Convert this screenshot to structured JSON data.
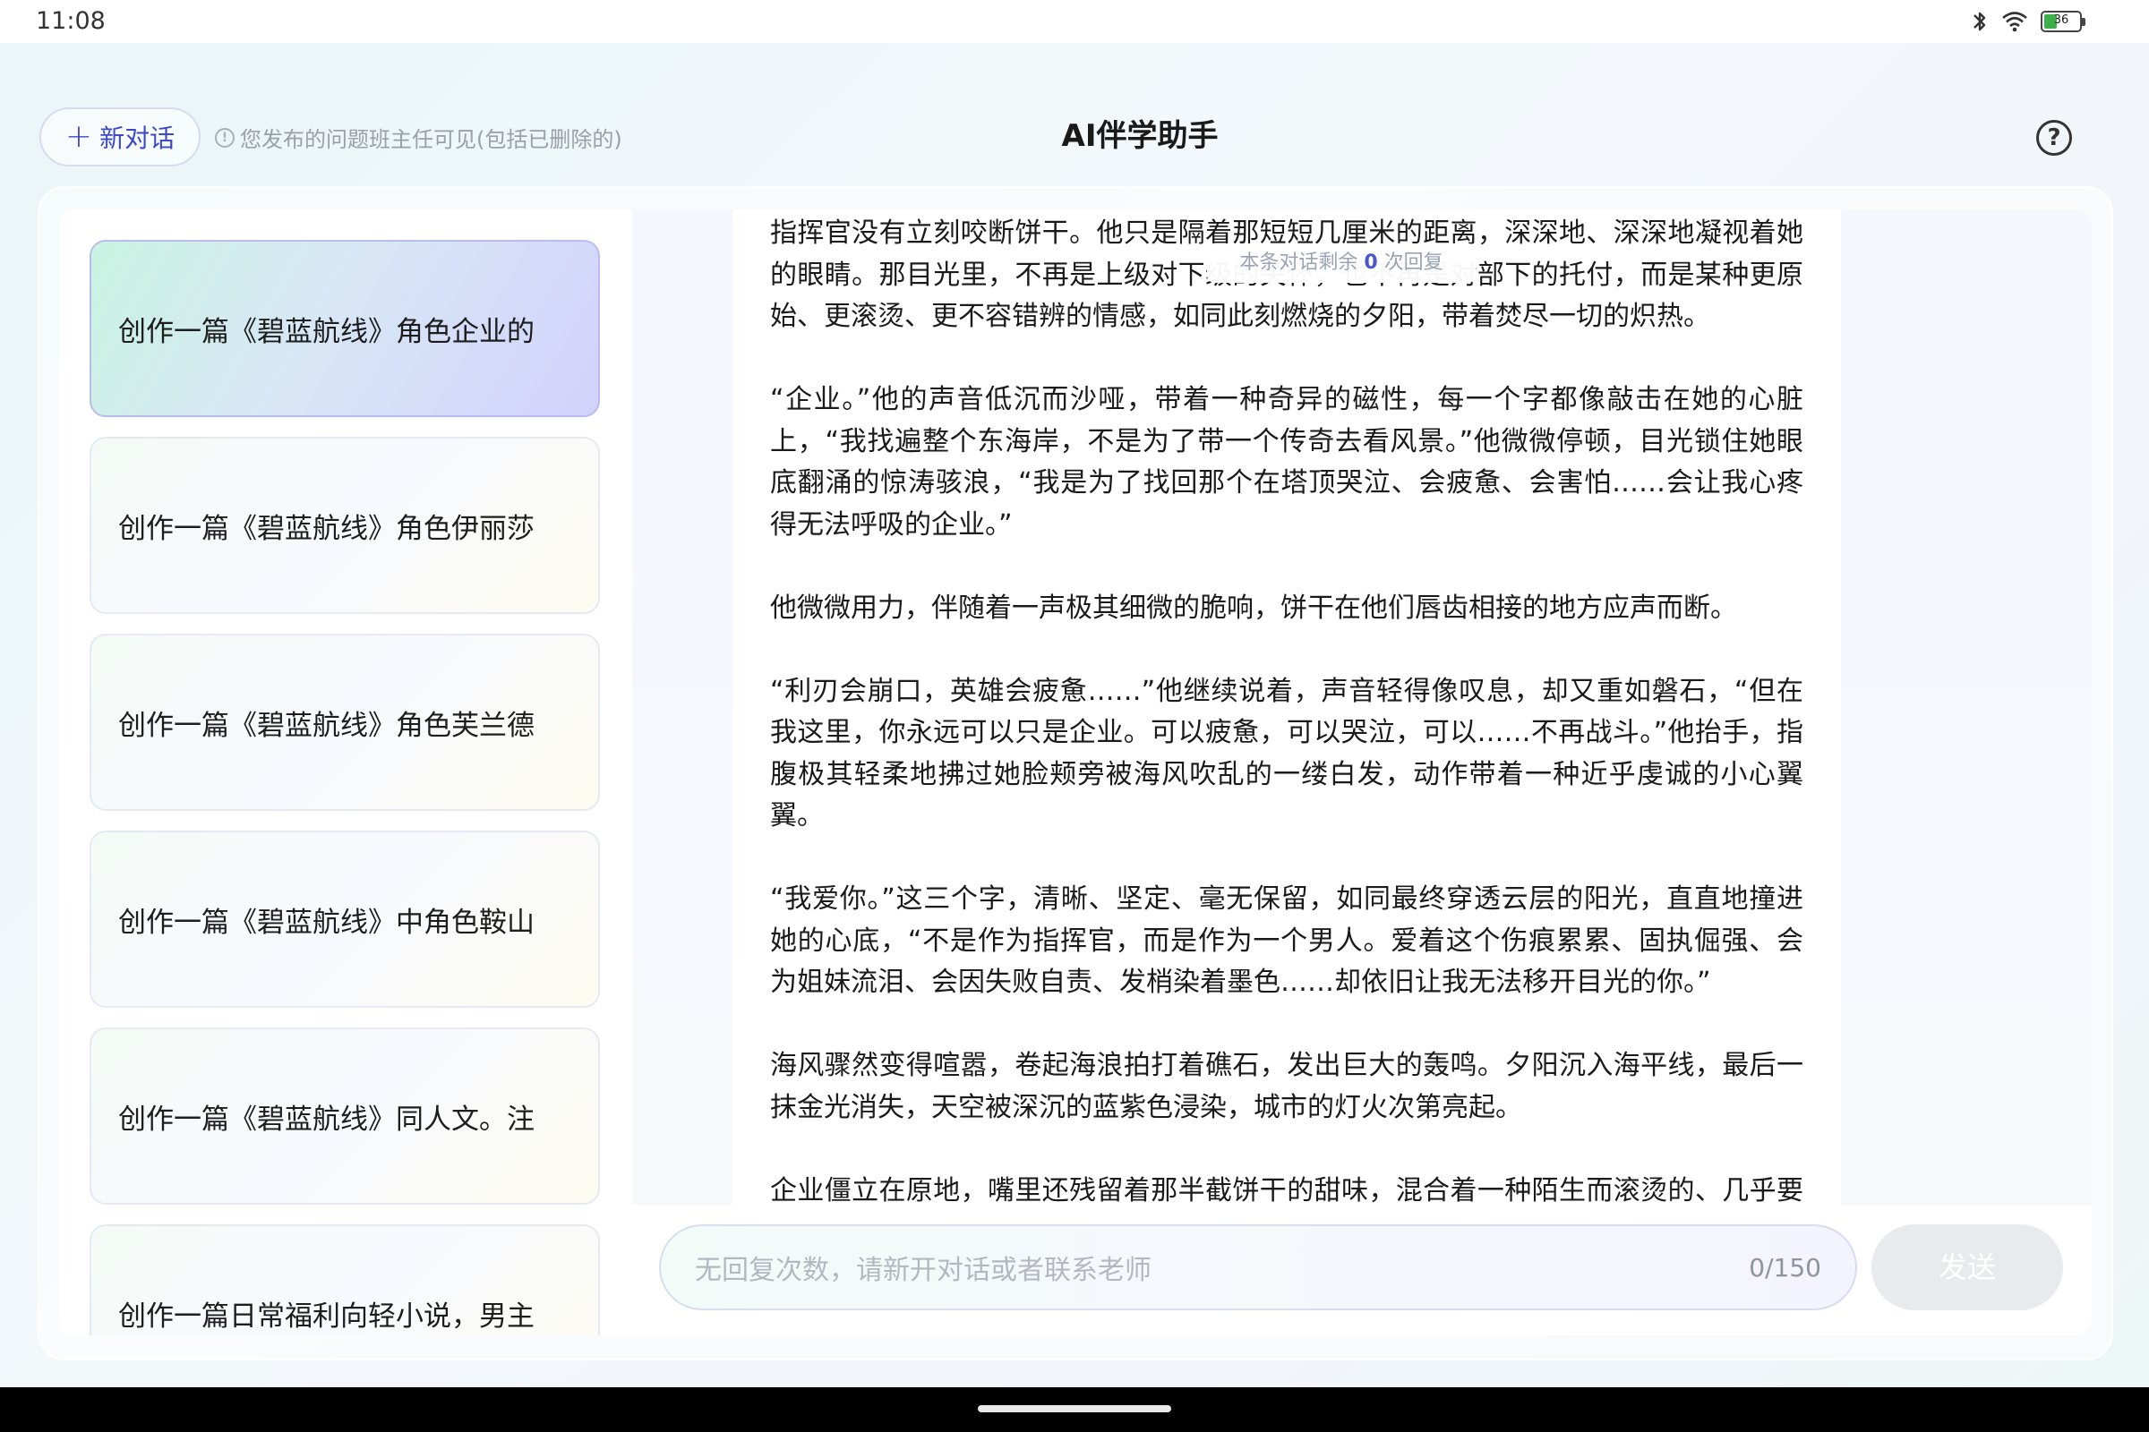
{
  "status_bar": {
    "time": "11:08",
    "battery_level": "36",
    "battery_fraction": 0.36,
    "icons": [
      "bluetooth-icon",
      "wifi-icon",
      "battery-icon"
    ]
  },
  "header": {
    "new_chat_label": "新对话",
    "notice_text": "您发布的问题班主任可见(包括已删除的)",
    "title": "AI伴学助手",
    "help_icon": "?"
  },
  "sidebar": {
    "conversations": [
      {
        "title": "创作一篇《碧蓝航线》角色企业的",
        "active": true
      },
      {
        "title": "创作一篇《碧蓝航线》角色伊丽莎",
        "active": false
      },
      {
        "title": "创作一篇《碧蓝航线》角色芙兰德",
        "active": false
      },
      {
        "title": "创作一篇《碧蓝航线》中角色鞍山",
        "active": false
      },
      {
        "title": "创作一篇《碧蓝航线》同人文。注",
        "active": false
      },
      {
        "title": "创作一篇日常福利向轻小说，男主",
        "active": false
      }
    ]
  },
  "chat": {
    "reply_tip_prefix": "本条对话剩余",
    "reply_tip_count": "0",
    "reply_tip_suffix": "次回复",
    "paragraphs": [
      "指挥官没有立刻咬断饼干。他只是隔着那短短几厘米的距离，深深地、深深地凝视着她的眼睛。那目光里，不再是上级对下级的关怀，也不再是对部下的托付，而是某种更原始、更滚烫、更不容错辨的情感，如同此刻燃烧的夕阳，带着焚尽一切的炽热。",
      "“企业。”他的声音低沉而沙哑，带着一种奇异的磁性，每一个字都像敲击在她的心脏上，“我找遍整个东海岸，不是为了带一个传奇去看风景。”他微微停顿，目光锁住她眼底翻涌的惊涛骇浪，“我是为了找回那个在塔顶哭泣、会疲惫、会害怕……会让我心疼得无法呼吸的企业。”",
      "他微微用力，伴随着一声极其细微的脆响，饼干在他们唇齿相接的地方应声而断。",
      "“利刃会崩口，英雄会疲惫……”他继续说着，声音轻得像叹息，却又重如磐石，“但在我这里，你永远可以只是企业。可以疲惫，可以哭泣，可以……不再战斗。”他抬手，指腹极其轻柔地拂过她脸颊旁被海风吹乱的一缕白发，动作带着一种近乎虔诚的小心翼翼。",
      "“我爱你。”这三个字，清晰、坚定、毫无保留，如同最终穿透云层的阳光，直直地撞进她的心底，“不是作为指挥官，而是作为一个男人。爱着这个伤痕累累、固执倔强、会为姐妹流泪、会因失败自责、发梢染着墨色……却依旧让我无法移开目光的你。”",
      "海风骤然变得喧嚣，卷起海浪拍打着礁石，发出巨大的轰鸣。夕阳沉入海平线，最后一抹金光消失，天空被深沉的蓝紫色浸染，城市的灯火次第亮起。",
      "企业僵立在原地，嘴里还残留着那半截饼干的甜味，混合着一种陌生而滚烫的、几乎要将她融化的情感。她看着眼前这张近在咫尺的脸，看着他眼中毫不掩饰的、如同星辰大"
    ]
  },
  "input": {
    "placeholder": "无回复次数，请新开对话或者联系老师",
    "counter": "0/150",
    "send_label": "发送"
  }
}
